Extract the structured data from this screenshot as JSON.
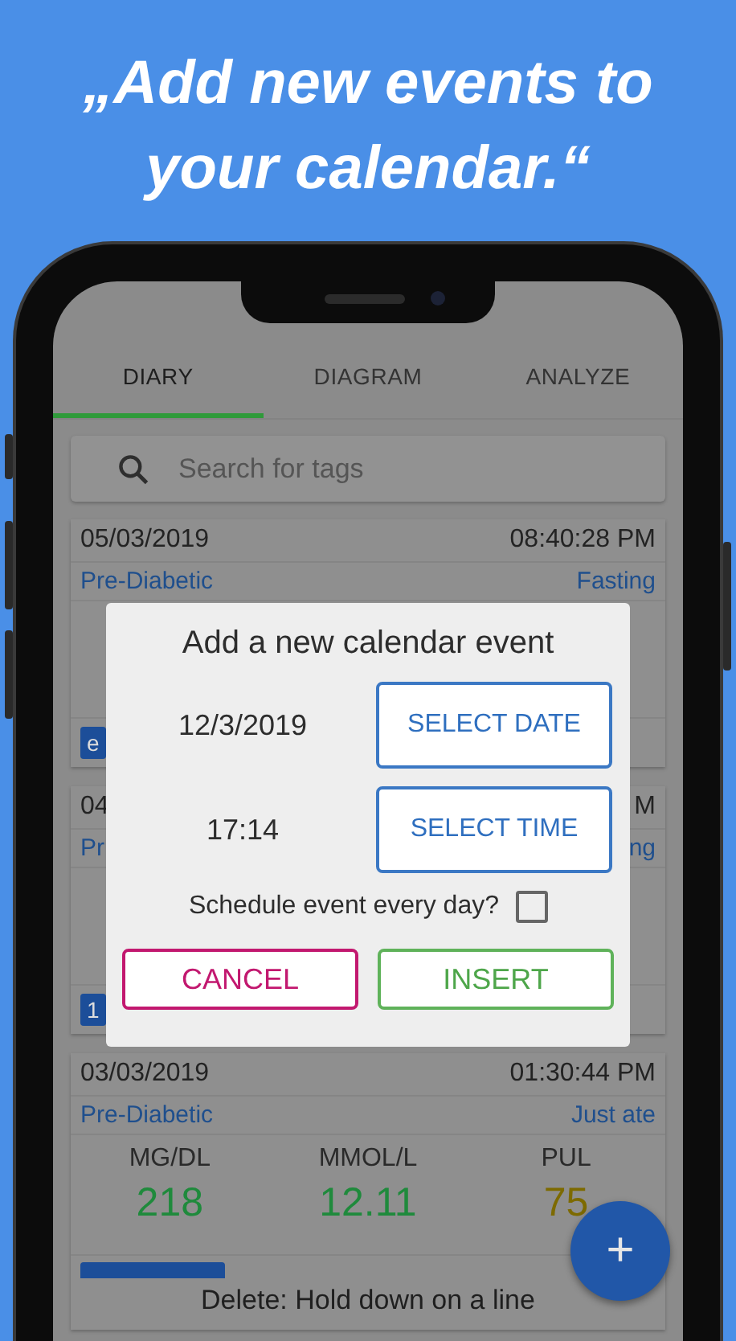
{
  "headline_lines": [
    "„Add new events to",
    "your calendar.“"
  ],
  "tabs": [
    {
      "label": "DIARY",
      "selected": true
    },
    {
      "label": "DIAGRAM",
      "selected": false
    },
    {
      "label": "ANALYZE",
      "selected": false
    }
  ],
  "search": {
    "placeholder": "Search for tags"
  },
  "entries": [
    {
      "date": "05/03/2019",
      "time": "08:40:28 PM",
      "category": "Pre-Diabetic",
      "context": "Fasting",
      "tags": [
        {
          "kind": "chip",
          "label": "e"
        }
      ]
    },
    {
      "date": "04",
      "time": "M",
      "category": "Pr",
      "context": "ng",
      "tags": [
        {
          "kind": "chip",
          "label": "1"
        }
      ]
    },
    {
      "date": "03/03/2019",
      "time": "01:30:44 PM",
      "category": "Pre-Diabetic",
      "context": "Just ate",
      "readings": [
        {
          "label": "MG/DL",
          "value": "218",
          "color": "#1f8a3c"
        },
        {
          "label": "MMOL/L",
          "value": "12.11",
          "color": "#1f8a3c"
        },
        {
          "label": "PUL",
          "value": "75",
          "color": "#7d6a00"
        }
      ],
      "tags": [
        {
          "kind": "bar"
        }
      ],
      "footer": "Delete: Hold down on a line"
    }
  ],
  "dialog": {
    "title": "Add a new calendar event",
    "pickers": [
      {
        "value": "12/3/2019",
        "button": "SELECT DATE"
      },
      {
        "value": "17:14",
        "button": "SELECT TIME"
      }
    ],
    "checkbox": {
      "label": "Schedule event every day?",
      "checked": false
    },
    "actions": [
      {
        "label": "CANCEL",
        "kind": "cancel"
      },
      {
        "label": "INSERT",
        "kind": "confirm"
      }
    ]
  },
  "fab": {
    "label": "+"
  }
}
